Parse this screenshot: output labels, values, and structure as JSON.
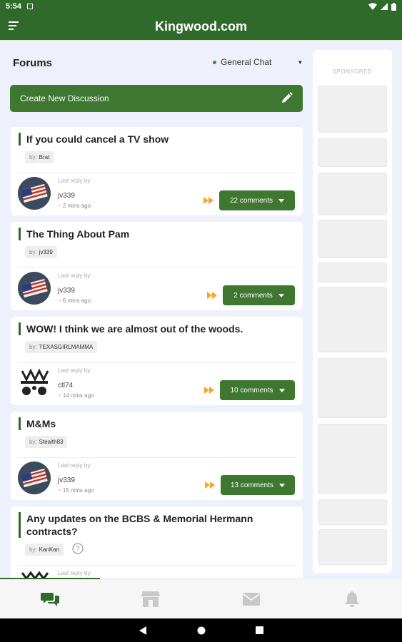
{
  "status_bar": {
    "time": "5:54"
  },
  "app": {
    "title": "Kingwood.com"
  },
  "forums": {
    "heading": "Forums",
    "filter_label": "General Chat",
    "create_button": "Create New Discussion",
    "by_prefix": "by:",
    "last_reply_label": "Last reply by:",
    "threads": [
      {
        "title": "If you could cancel a TV show",
        "author": "Brat",
        "last_user": "jv339",
        "last_time": "~ 2 mins ago",
        "comments": "22 comments"
      },
      {
        "title": "The Thing About Pam",
        "author": "jv339",
        "last_user": "jv339",
        "last_time": "~ 6 mins ago",
        "comments": "2 comments"
      },
      {
        "title": "WOW!  I think we are almost out of the woods.",
        "author": "TEXASGIRLMAMMA",
        "last_user": "ctl74",
        "last_time": "~ 14 mins ago",
        "comments": "10 comments"
      },
      {
        "title": "M&Ms",
        "author": "Stealth83",
        "last_user": "jv339",
        "last_time": "~ 15 mins ago",
        "comments": "13 comments"
      },
      {
        "title": "Any updates on the BCBS & Memorial Hermann contracts?",
        "author": "KanKan",
        "last_user": "",
        "last_time": "",
        "comments": ""
      }
    ]
  },
  "sidebar": {
    "label": "SPONSORED"
  },
  "tabs": [
    {
      "icon": "chat-icon",
      "active": true
    },
    {
      "icon": "store-icon",
      "active": false
    },
    {
      "icon": "mail-icon",
      "active": false
    },
    {
      "icon": "bell-icon",
      "active": false
    }
  ],
  "colors": {
    "brand": "#2f6a2a",
    "button": "#3d7730",
    "accent": "#f5a623",
    "background": "#eef1fb"
  }
}
